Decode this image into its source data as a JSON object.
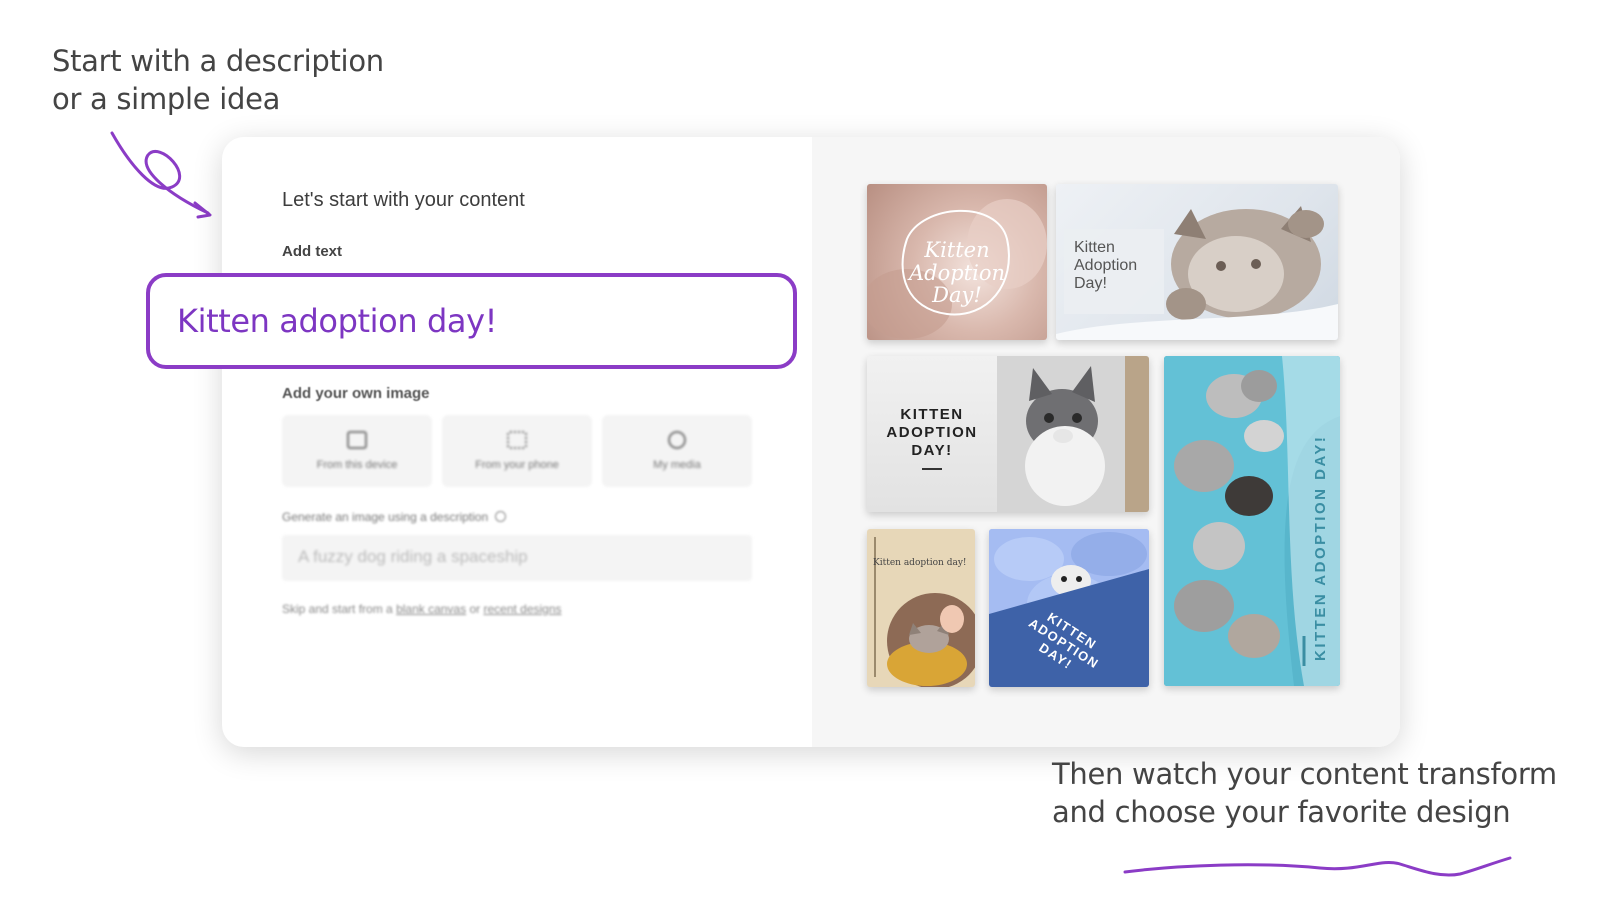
{
  "callouts": {
    "top_line1": "Start with a description",
    "top_line2": "or a simple idea",
    "bottom_line1": "Then watch your content transform",
    "bottom_line2": "and choose your favorite design"
  },
  "editor": {
    "title": "Let's start with your content",
    "add_text_label": "Add text",
    "text_value": "Kitten adoption day!",
    "own_image_label": "Add your own image",
    "image_options": [
      {
        "label": "From this device",
        "icon": "monitor-icon"
      },
      {
        "label": "From your phone",
        "icon": "qr-code-icon"
      },
      {
        "label": "My media",
        "icon": "media-icon"
      }
    ],
    "generate_label": "Generate an image using a description",
    "generate_placeholder": "A fuzzy dog riding a spaceship",
    "skip_prefix": "Skip and start from a",
    "blank_canvas_link": "blank canvas",
    "or": "or",
    "recent_designs_link": "recent designs"
  },
  "designs": [
    {
      "text": "Kitten Adoption Day!"
    },
    {
      "text_lines": [
        "Kitten",
        "Adoption",
        "Day!"
      ]
    },
    {
      "text_lines": [
        "KITTEN",
        "ADOPTION",
        "DAY!"
      ]
    },
    {
      "text": "KITTEN ADOPTION DAY!"
    },
    {
      "text": "Kitten adoption day!"
    },
    {
      "text_lines": [
        "KITTEN",
        "ADOPTION",
        "DAY!"
      ]
    }
  ],
  "colors": {
    "accent_purple": "#8b3cc6",
    "text_purple": "#7d36c2"
  }
}
